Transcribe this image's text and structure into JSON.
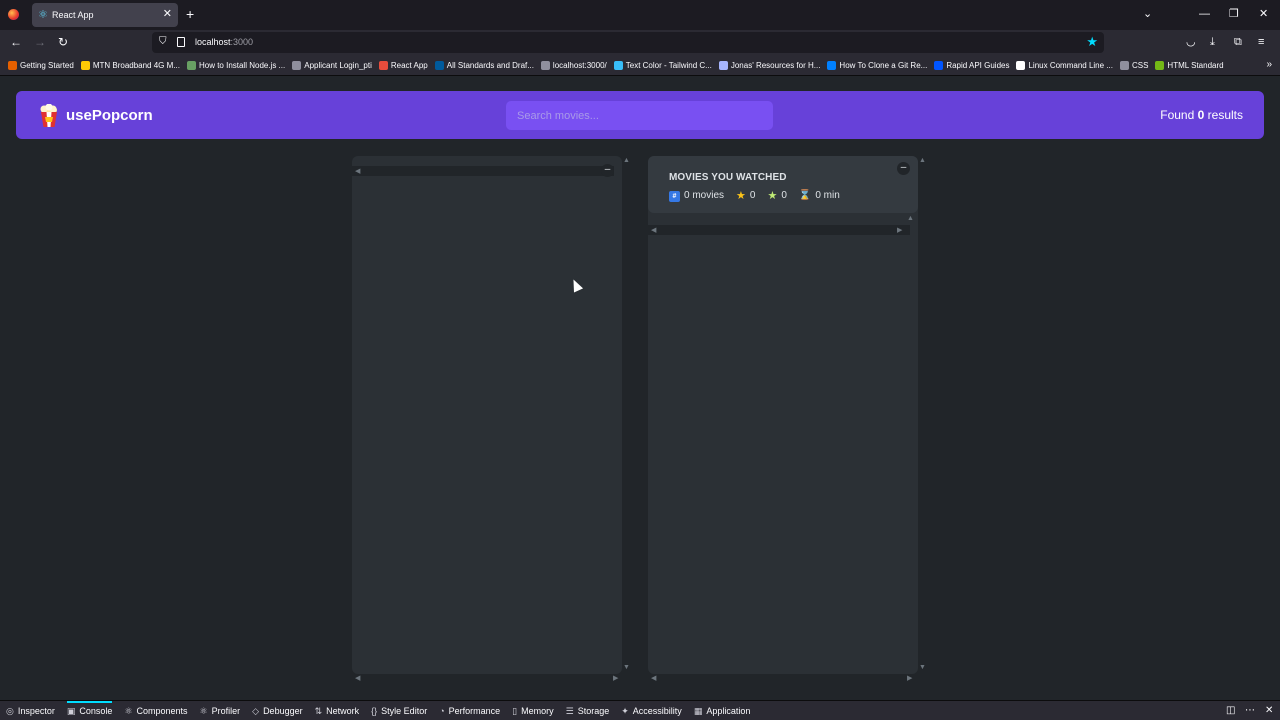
{
  "browser": {
    "tab_title": "React App",
    "url": "localhost",
    "url_port": ":3000",
    "bookmarks": [
      {
        "label": "Getting Started",
        "color": "#e66000"
      },
      {
        "label": "MTN Broadband 4G M...",
        "color": "#ffcb05"
      },
      {
        "label": "How to Install Node.js ...",
        "color": "#68a063"
      },
      {
        "label": "Applicant Login_pti",
        "color": "#8f8f9d"
      },
      {
        "label": "React App",
        "color": "#e74c3c"
      },
      {
        "label": "All Standards and Draf...",
        "color": "#005a9c"
      },
      {
        "label": "localhost:3000/",
        "color": "#8f8f9d"
      },
      {
        "label": "Text Color - Tailwind C...",
        "color": "#38bdf8"
      },
      {
        "label": "Jonas' Resources for H...",
        "color": "#a5b4fc"
      },
      {
        "label": "How To Clone a Git Re...",
        "color": "#0080ff"
      },
      {
        "label": "Rapid API Guides",
        "color": "#0055ff"
      },
      {
        "label": "Linux Command Line ...",
        "color": "#ffffff"
      },
      {
        "label": "CSS",
        "color": "#8f8f9d"
      },
      {
        "label": "HTML Standard",
        "color": "#74b816"
      }
    ]
  },
  "app": {
    "logo_text": "usePopcorn",
    "search_placeholder": "Search movies...",
    "results_prefix": "Found",
    "results_count": "0",
    "results_suffix": "results",
    "left_toggle": "–",
    "right_toggle": "–",
    "watched": {
      "title": "MOVIES YOU WATCHED",
      "movies": "0 movies",
      "imdb_rating": "0",
      "user_rating": "0",
      "runtime": "0 min"
    }
  },
  "devtools": {
    "tabs": [
      {
        "label": "Inspector",
        "icon": "◎"
      },
      {
        "label": "Console",
        "icon": "▣",
        "active": true
      },
      {
        "label": "Components",
        "icon": "⚛"
      },
      {
        "label": "Profiler",
        "icon": "⚛"
      },
      {
        "label": "Debugger",
        "icon": "◇"
      },
      {
        "label": "Network",
        "icon": "⇅"
      },
      {
        "label": "Style Editor",
        "icon": "{}"
      },
      {
        "label": "Performance",
        "icon": "◔"
      },
      {
        "label": "Memory",
        "icon": "▯"
      },
      {
        "label": "Storage",
        "icon": "☰"
      },
      {
        "label": "Accessibility",
        "icon": "✦"
      },
      {
        "label": "Application",
        "icon": "▦"
      }
    ]
  }
}
